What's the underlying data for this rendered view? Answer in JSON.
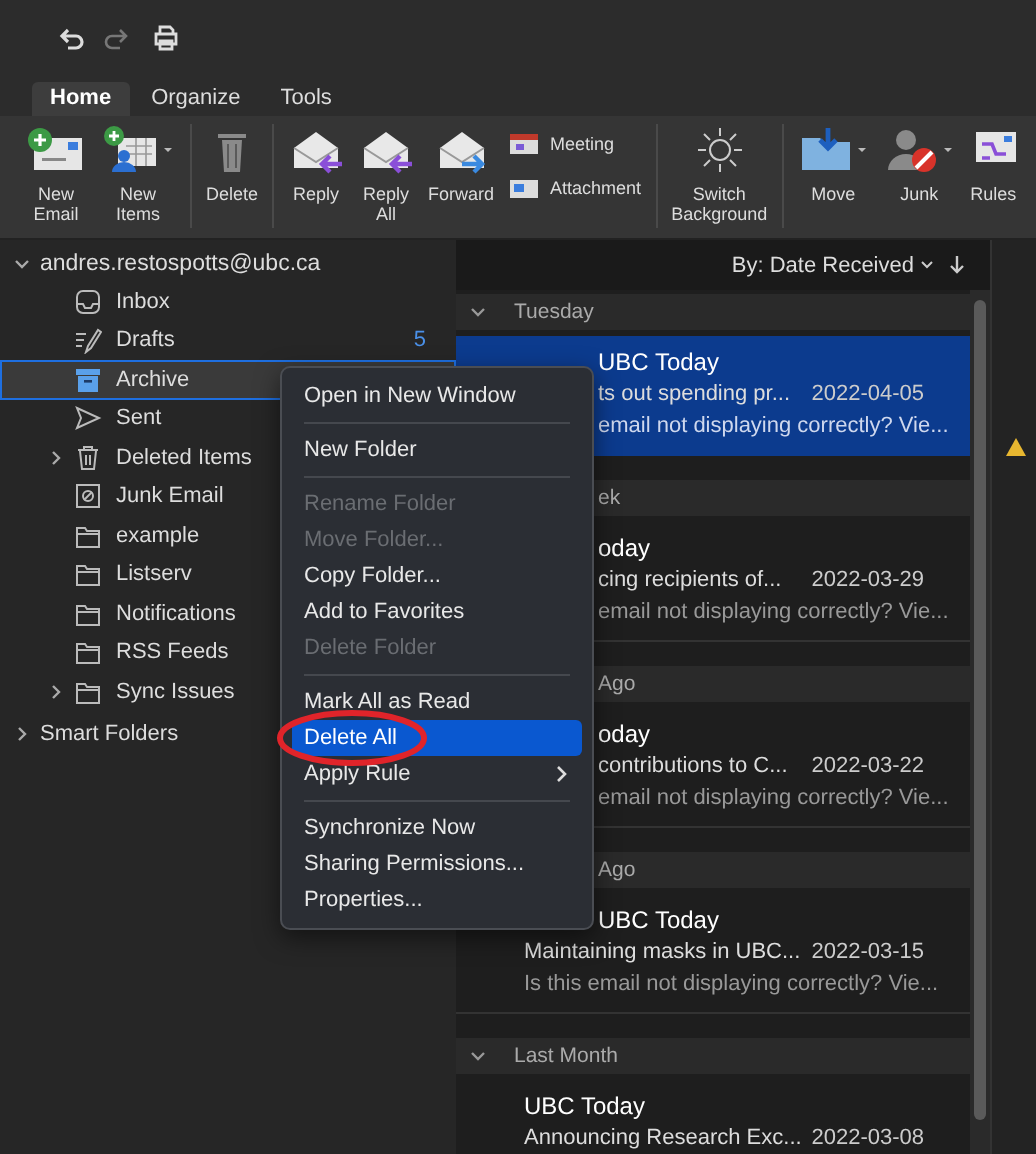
{
  "tabs": [
    {
      "label": "Home",
      "selected": true
    },
    {
      "label": "Organize",
      "selected": false
    },
    {
      "label": "Tools",
      "selected": false
    }
  ],
  "ribbon": [
    [
      {
        "kind": "large",
        "label": "New Email",
        "menu": false
      },
      {
        "kind": "large",
        "label": "New Items",
        "menu": true
      }
    ],
    [
      {
        "kind": "large",
        "label": "Delete",
        "menu": false
      }
    ],
    [
      {
        "kind": "large",
        "label": "Reply",
        "menu": false
      },
      {
        "kind": "large",
        "label": "Reply All",
        "menu": false
      },
      {
        "kind": "large",
        "label": "Forward",
        "menu": false
      },
      {
        "kind": "small",
        "label": "Meeting",
        "menu": false
      },
      {
        "kind": "small",
        "label": "Attachment",
        "menu": false
      }
    ],
    [
      {
        "kind": "large",
        "label": "Switch Background",
        "menu": false
      }
    ],
    [
      {
        "kind": "large",
        "label": "Move",
        "menu": true
      },
      {
        "kind": "large",
        "label": "Junk",
        "menu": true
      },
      {
        "kind": "large",
        "label": "Rules",
        "menu": false
      }
    ]
  ],
  "sidebar": {
    "account": {
      "label": "andres.restospotts@ubc.ca",
      "expanded": true
    },
    "folders": [
      {
        "kind": "inbox",
        "label": "Inbox",
        "selected": false
      },
      {
        "kind": "drafts",
        "label": "Drafts",
        "count": "5",
        "selected": false
      },
      {
        "kind": "archive",
        "label": "Archive",
        "selected": true
      },
      {
        "kind": "sent",
        "label": "Sent",
        "selected": false
      },
      {
        "kind": "trash",
        "label": "Deleted Items",
        "selected": false,
        "expanded": false
      },
      {
        "kind": "junk",
        "label": "Junk Email",
        "selected": false
      },
      {
        "kind": "folder",
        "label": "example",
        "selected": false
      },
      {
        "kind": "folder",
        "label": "Listserv",
        "selected": false
      },
      {
        "kind": "folder",
        "label": "Notifications",
        "selected": false
      },
      {
        "kind": "folder",
        "label": "RSS Feeds",
        "selected": false
      },
      {
        "kind": "folder",
        "label": "Sync Issues",
        "selected": false,
        "expanded": false
      }
    ],
    "smart_folders": {
      "label": "Smart Folders",
      "expanded": false
    }
  },
  "message_list": {
    "sort_label": "By: Date Received",
    "groups": [
      {
        "label": "Tuesday",
        "expanded": true,
        "messages": [
          {
            "sender": "UBC Today",
            "subject": "ts out spending pr...",
            "date": "2022-04-05",
            "preview": "email not displaying correctly? Vie...",
            "selected": true
          }
        ]
      },
      {
        "label": "ek",
        "messages": [
          {
            "sender": "oday",
            "subject": "cing recipients of...",
            "date": "2022-03-29",
            "preview": "email not displaying correctly? Vie...",
            "selected": false
          }
        ]
      },
      {
        "label": "Ago",
        "messages": [
          {
            "sender": "oday",
            "subject": "contributions to C...",
            "date": "2022-03-22",
            "preview": "email not displaying correctly? Vie...",
            "selected": false
          }
        ]
      },
      {
        "label": "Ago",
        "messages": [
          {
            "sender": "UBC Today",
            "subject": "Maintaining masks in UBC...",
            "date": "2022-03-15",
            "preview": "Is this email not displaying correctly? Vie...",
            "selected": false
          }
        ]
      },
      {
        "label": "Last Month",
        "expanded": true,
        "messages": [
          {
            "sender": "UBC Today",
            "subject": "Announcing Research Exc...",
            "date": "2022-03-08",
            "selected": false
          }
        ]
      }
    ]
  },
  "context_menu": {
    "sections": [
      [
        {
          "label": "Open in New Window",
          "disabled": false,
          "selected": false
        }
      ],
      [
        {
          "label": "New Folder",
          "disabled": false,
          "selected": false
        }
      ],
      [
        {
          "label": "Rename Folder",
          "disabled": true,
          "selected": false
        },
        {
          "label": "Move Folder...",
          "disabled": true,
          "selected": false
        },
        {
          "label": "Copy Folder...",
          "disabled": false,
          "selected": false
        },
        {
          "label": "Add to Favorites",
          "disabled": false,
          "selected": false
        },
        {
          "label": "Delete Folder",
          "disabled": true,
          "selected": false
        }
      ],
      [
        {
          "label": "Mark All as Read",
          "disabled": false,
          "selected": false
        },
        {
          "label": "Delete All",
          "disabled": false,
          "selected": true,
          "circled": true
        },
        {
          "label": "Apply Rule",
          "disabled": false,
          "selected": false,
          "submenu": true
        }
      ],
      [
        {
          "label": "Synchronize Now",
          "disabled": false,
          "selected": false
        },
        {
          "label": "Sharing Permissions...",
          "disabled": false,
          "selected": false
        },
        {
          "label": "Properties...",
          "disabled": false,
          "selected": false
        }
      ]
    ]
  }
}
